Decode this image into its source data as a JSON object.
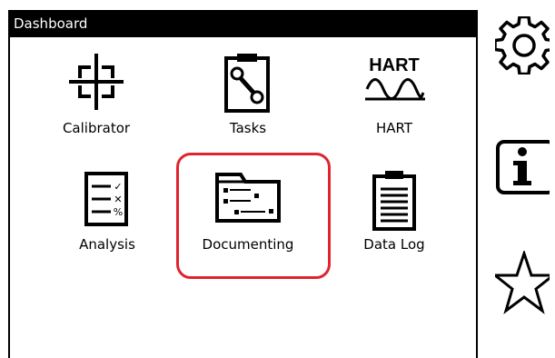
{
  "window": {
    "title": "Dashboard"
  },
  "tiles": [
    {
      "label": "Calibrator",
      "icon": "crosshair-icon"
    },
    {
      "label": "Tasks",
      "icon": "clipboard-wrench-icon"
    },
    {
      "label": "HART",
      "icon": "hart-wave-icon",
      "icon_text": "HART"
    },
    {
      "label": "Analysis",
      "icon": "checklist-icon"
    },
    {
      "label": "Documenting",
      "icon": "folder-flow-icon",
      "selected": true
    },
    {
      "label": "Data Log",
      "icon": "clipboard-list-icon"
    }
  ],
  "side_icons": [
    "gear-icon",
    "info-icon",
    "star-icon"
  ],
  "colors": {
    "highlight": "#e0242e",
    "titlebar": "#000000"
  }
}
